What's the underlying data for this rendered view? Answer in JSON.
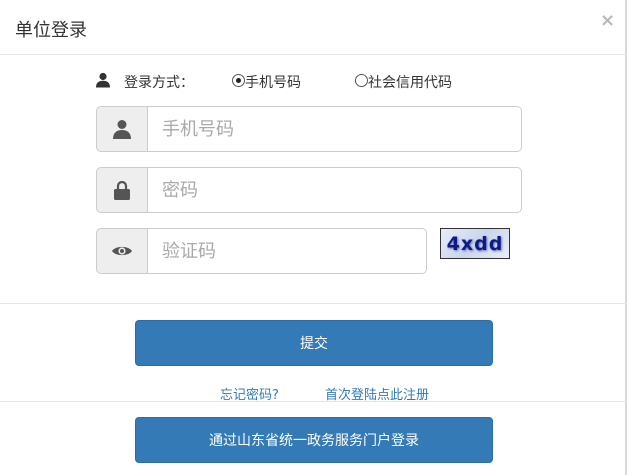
{
  "modal": {
    "title": "单位登录",
    "close_label": "×"
  },
  "login_method": {
    "label": "登录方式：",
    "icon": "user-icon",
    "options": [
      {
        "label": "手机号码",
        "selected": true
      },
      {
        "label": "社会信用代码",
        "selected": false
      }
    ]
  },
  "fields": {
    "phone": {
      "placeholder": "手机号码",
      "value": "",
      "icon": "user-icon"
    },
    "password": {
      "placeholder": "密码",
      "value": "",
      "icon": "lock-icon"
    },
    "captcha": {
      "placeholder": "验证码",
      "value": "",
      "icon": "eye-icon"
    }
  },
  "captcha_image_text": "4xdd",
  "buttons": {
    "submit": "提交",
    "portal_login": "通过山东省统一政务服务门户登录"
  },
  "links": {
    "forgot_password": "忘记密码?",
    "register": "首次登陆点此注册"
  },
  "colors": {
    "primary": "#337ab7",
    "addon_bg": "#eeeeee",
    "border": "#cccccc"
  }
}
